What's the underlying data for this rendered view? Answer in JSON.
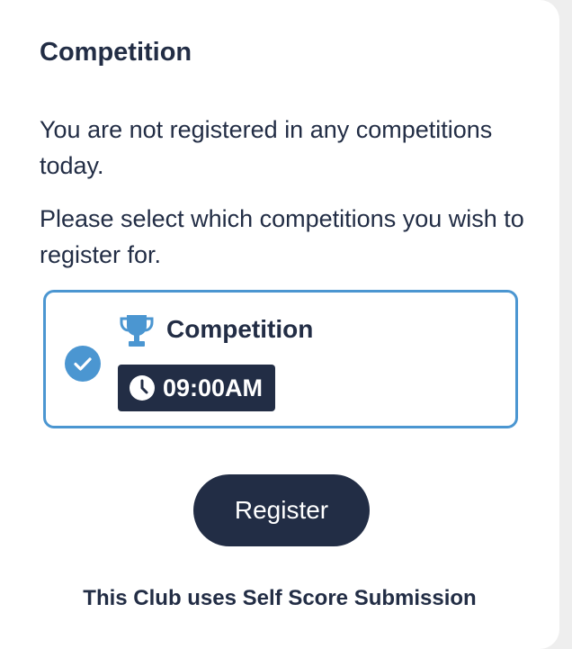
{
  "card": {
    "title": "Competition",
    "not_registered_text": "You are not registered in any competitions today.",
    "instruction_text": "Please select which competitions you wish to register for."
  },
  "competition_option": {
    "selected": true,
    "name": "Competition",
    "time": "09:00AM",
    "icons": {
      "trophy": "trophy-icon",
      "clock": "clock-icon",
      "check": "check-icon"
    }
  },
  "actions": {
    "register_label": "Register"
  },
  "footer": {
    "text": "This Club uses Self Score Submission"
  },
  "colors": {
    "primary_navy": "#222d45",
    "accent_blue": "#4b96d1",
    "background": "#eeeeee",
    "card": "#ffffff"
  }
}
